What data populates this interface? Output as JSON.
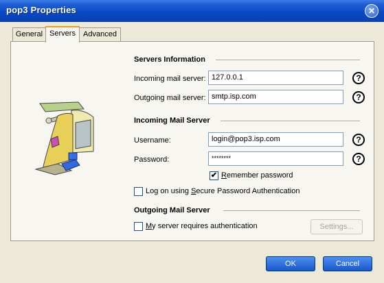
{
  "window": {
    "title": "pop3 Properties",
    "close_glyph": "✕"
  },
  "tabs": [
    {
      "label": "General",
      "active": false
    },
    {
      "label": "Servers",
      "active": true
    },
    {
      "label": "Advanced",
      "active": false
    }
  ],
  "servers_info": {
    "heading": "Servers Information",
    "incoming_label": "Incoming mail server:",
    "incoming_value": "127.0.0.1",
    "outgoing_label": "Outgoing mail server:",
    "outgoing_value": "smtp.isp.com"
  },
  "incoming_server": {
    "heading": "Incoming Mail Server",
    "username_label": "Username:",
    "username_value": "login@pop3.isp.com",
    "password_label": "Password:",
    "password_value": "********",
    "remember_password": {
      "label_prefix": "",
      "accel": "R",
      "label_rest": "emember password",
      "checked": true
    },
    "spa": {
      "label_prefix": "Log on using ",
      "accel": "S",
      "label_rest": "ecure Password Authentication",
      "checked": false
    }
  },
  "outgoing_server": {
    "heading": "Outgoing Mail Server",
    "auth": {
      "label_prefix": "",
      "accel": "M",
      "label_rest": "y server requires authentication",
      "checked": false
    },
    "settings_label": "Settings..."
  },
  "help_glyph": "?",
  "footer": {
    "ok_label": "OK",
    "cancel_label": "Cancel"
  }
}
